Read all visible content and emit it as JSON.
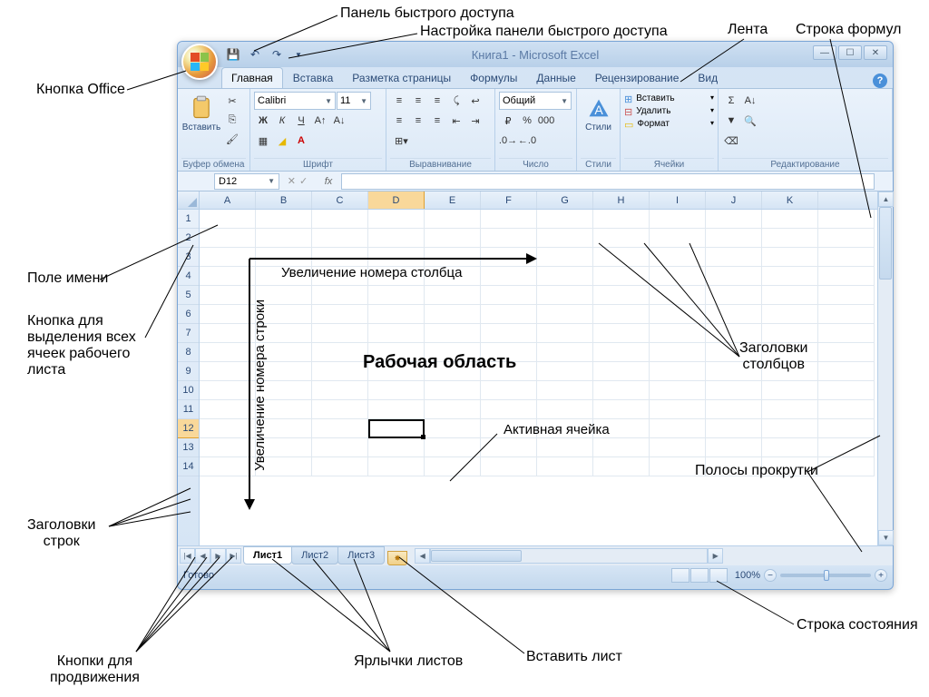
{
  "callouts": {
    "qat": "Панель быстрого доступа",
    "qat_custom": "Настройка панели быстрого доступа",
    "ribbon": "Лента",
    "formula_bar": "Строка формул",
    "office_btn": "Кнопка Office",
    "name_box": "Поле имени",
    "select_all": "Кнопка для\nвыделения всех\nячеек рабочего\nлиста",
    "row_headers": "Заголовки\nстрок",
    "nav_btns": "Кнопки для\nпродвижения",
    "sheet_tabs": "Ярлычки листов",
    "insert_sheet": "Вставить лист",
    "status_bar": "Строка состояния",
    "scrollbars": "Полосы прокрутки",
    "col_headers": "Заголовки\nстолбцов",
    "work_area": "Рабочая область",
    "active_cell": "Активная ячейка",
    "col_inc": "Увеличение номера столбца",
    "row_inc": "Увеличение номера строки"
  },
  "title": "Книга1 - Microsoft Excel",
  "tabs": [
    "Главная",
    "Вставка",
    "Разметка страницы",
    "Формулы",
    "Данные",
    "Рецензирование",
    "Вид"
  ],
  "active_tab": 0,
  "groups": {
    "clipboard": "Буфер обмена",
    "font": "Шрифт",
    "alignment": "Выравнивание",
    "number": "Число",
    "styles": "Стили",
    "cells": "Ячейки",
    "editing": "Редактирование"
  },
  "paste_label": "Вставить",
  "font_name": "Calibri",
  "font_size": "11",
  "number_format": "Общий",
  "cells_btns": {
    "insert": "Вставить",
    "delete": "Удалить",
    "format": "Формат"
  },
  "styles_btn": "Стили",
  "name_box": "D12",
  "columns": [
    "A",
    "B",
    "C",
    "D",
    "E",
    "F",
    "G",
    "H",
    "I",
    "J",
    "K"
  ],
  "rows": [
    1,
    2,
    3,
    4,
    5,
    6,
    7,
    8,
    9,
    10,
    11,
    12,
    13,
    14
  ],
  "active_row": 12,
  "active_col": "D",
  "sheets": [
    "Лист1",
    "Лист2",
    "Лист3"
  ],
  "active_sheet": 0,
  "status": "Готово",
  "zoom": "100%"
}
